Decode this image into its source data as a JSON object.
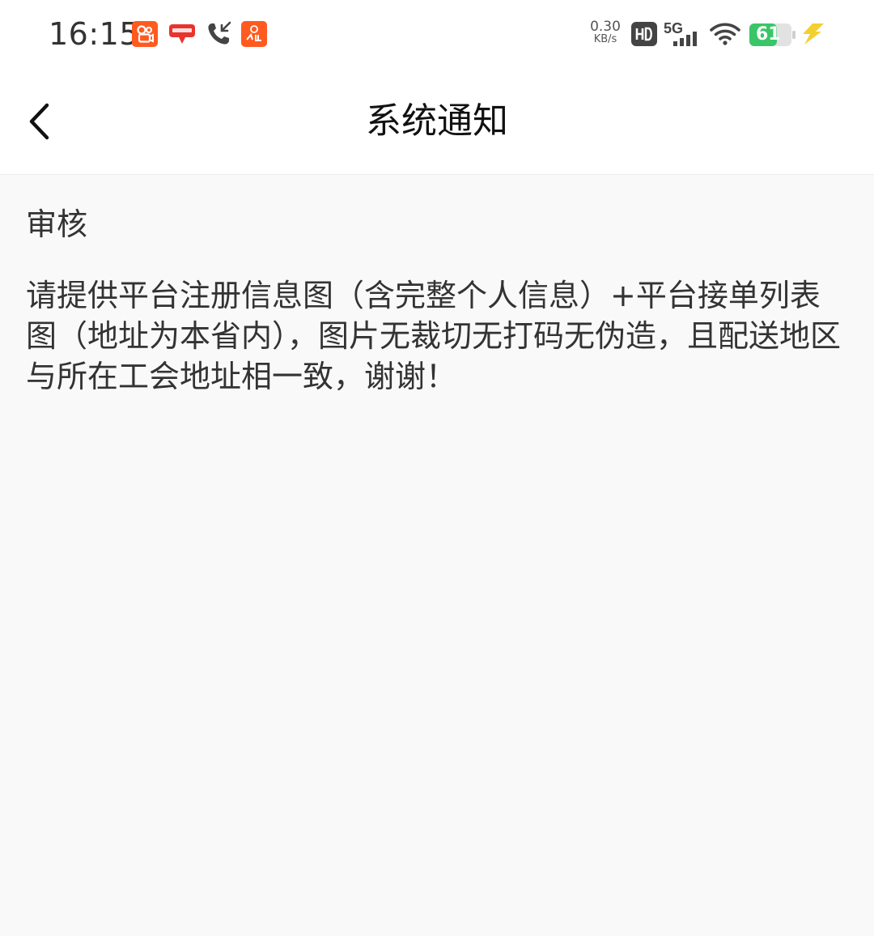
{
  "status_bar": {
    "time": "16:15",
    "net_speed_value": "0.30",
    "net_speed_unit": "KB/s",
    "battery": "61",
    "icons": [
      "kuaishou-icon",
      "yunshanfu-icon",
      "phone-call-icon",
      "fanqie-app-icon",
      "hd-icon",
      "5g-signal-icon",
      "wifi-icon",
      "battery-icon",
      "charging-icon"
    ],
    "colors": {
      "app_orange": "#ff5a1f",
      "app_red": "#e8342d",
      "battery_green": "#3ac569",
      "charging_yellow": "#f2d030"
    }
  },
  "nav": {
    "title": "系统通知",
    "back_icon": "chevron-left-icon"
  },
  "notice": {
    "heading": "审核",
    "body": "请提供平台注册信息图（含完整个人信息）+平台接单列表图（地址为本省内），图片无裁切无打码无伪造，且配送地区与所在工会地址相一致，谢谢！"
  }
}
